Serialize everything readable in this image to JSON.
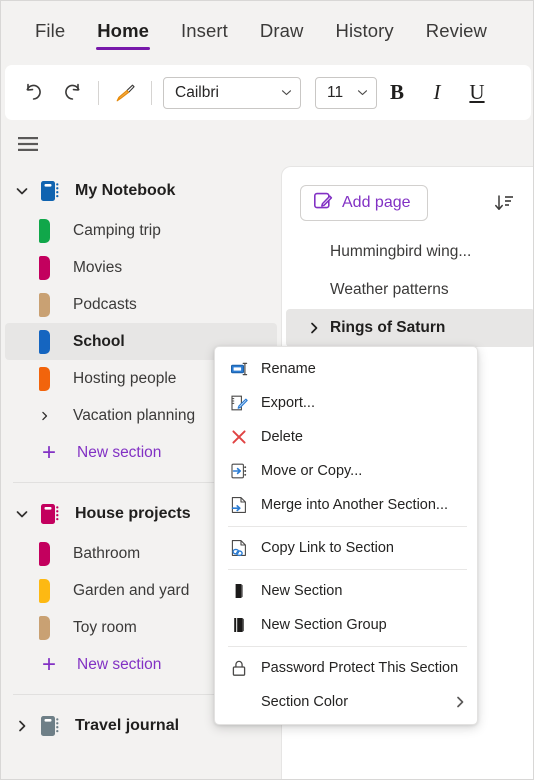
{
  "ribbon": {
    "tabs": [
      {
        "label": "File",
        "active": false
      },
      {
        "label": "Home",
        "active": true
      },
      {
        "label": "Insert",
        "active": false
      },
      {
        "label": "Draw",
        "active": false
      },
      {
        "label": "History",
        "active": false
      },
      {
        "label": "Review",
        "active": false
      }
    ],
    "accent_color": "#7719aa"
  },
  "toolbar": {
    "undo_icon": "undo-icon",
    "redo_icon": "redo-icon",
    "format_painter_icon": "format-painter-icon",
    "font_family": "Cailbri",
    "font_size": "11",
    "bold_label": "B",
    "italic_label": "I",
    "underline_label": "U"
  },
  "nav": {
    "toggle_icon": "hamburger-menu-icon"
  },
  "sidebar": {
    "notebooks": [
      {
        "name": "My Notebook",
        "expanded": true,
        "color": "#0f63b0",
        "sections": [
          {
            "label": "Camping trip",
            "color": "#10a74a",
            "type": "section",
            "selected": false
          },
          {
            "label": "Movies",
            "color": "#c3005e",
            "type": "section",
            "selected": false
          },
          {
            "label": "Podcasts",
            "color": "#c9a173",
            "type": "section",
            "selected": false
          },
          {
            "label": "School",
            "color": "#1565c0",
            "type": "section",
            "selected": true
          },
          {
            "label": "Hosting people",
            "color": "#f2640c",
            "type": "section",
            "selected": false
          },
          {
            "label": "Vacation planning",
            "color": "",
            "type": "group",
            "selected": false
          }
        ],
        "new_section_label": "New section"
      },
      {
        "name": "House projects",
        "expanded": true,
        "color": "#c3005e",
        "sections": [
          {
            "label": "Bathroom",
            "color": "#c3005e",
            "type": "section",
            "selected": false
          },
          {
            "label": "Garden and yard",
            "color": "#fdb913",
            "type": "section",
            "selected": false
          },
          {
            "label": "Toy room",
            "color": "#c9a173",
            "type": "section",
            "selected": false
          }
        ],
        "new_section_label": "New section"
      },
      {
        "name": "Travel journal",
        "expanded": false,
        "color": "#6e7f87",
        "sections": [],
        "new_section_label": ""
      }
    ]
  },
  "page_panel": {
    "add_page_label": "Add page",
    "add_page_icon": "new-page-icon",
    "sort_icon": "sort-descending-icon",
    "pages": [
      {
        "label": "Hummingbird wing...",
        "selected": false,
        "has_chevron": false
      },
      {
        "label": "Weather patterns",
        "selected": false,
        "has_chevron": false
      },
      {
        "label": "Rings of Saturn",
        "selected": true,
        "has_chevron": true
      }
    ]
  },
  "context_menu": {
    "items": [
      {
        "label": "Rename",
        "icon": "rename-icon",
        "separator_after": false,
        "submenu": false
      },
      {
        "label": "Export...",
        "icon": "export-icon",
        "separator_after": false,
        "submenu": false
      },
      {
        "label": "Delete",
        "icon": "delete-icon",
        "separator_after": false,
        "submenu": false
      },
      {
        "label": "Move or Copy...",
        "icon": "move-or-copy-icon",
        "separator_after": false,
        "submenu": false
      },
      {
        "label": "Merge into Another Section...",
        "icon": "merge-section-icon",
        "separator_after": true,
        "submenu": false
      },
      {
        "label": "Copy Link to Section",
        "icon": "copy-link-icon",
        "separator_after": true,
        "submenu": false
      },
      {
        "label": "New Section",
        "icon": "new-section-icon",
        "separator_after": false,
        "submenu": false
      },
      {
        "label": "New Section Group",
        "icon": "new-section-group-icon",
        "separator_after": true,
        "submenu": false
      },
      {
        "label": "Password Protect This Section",
        "icon": "lock-icon",
        "separator_after": false,
        "submenu": false
      },
      {
        "label": "Section Color",
        "icon": "",
        "separator_after": false,
        "submenu": true
      }
    ]
  }
}
